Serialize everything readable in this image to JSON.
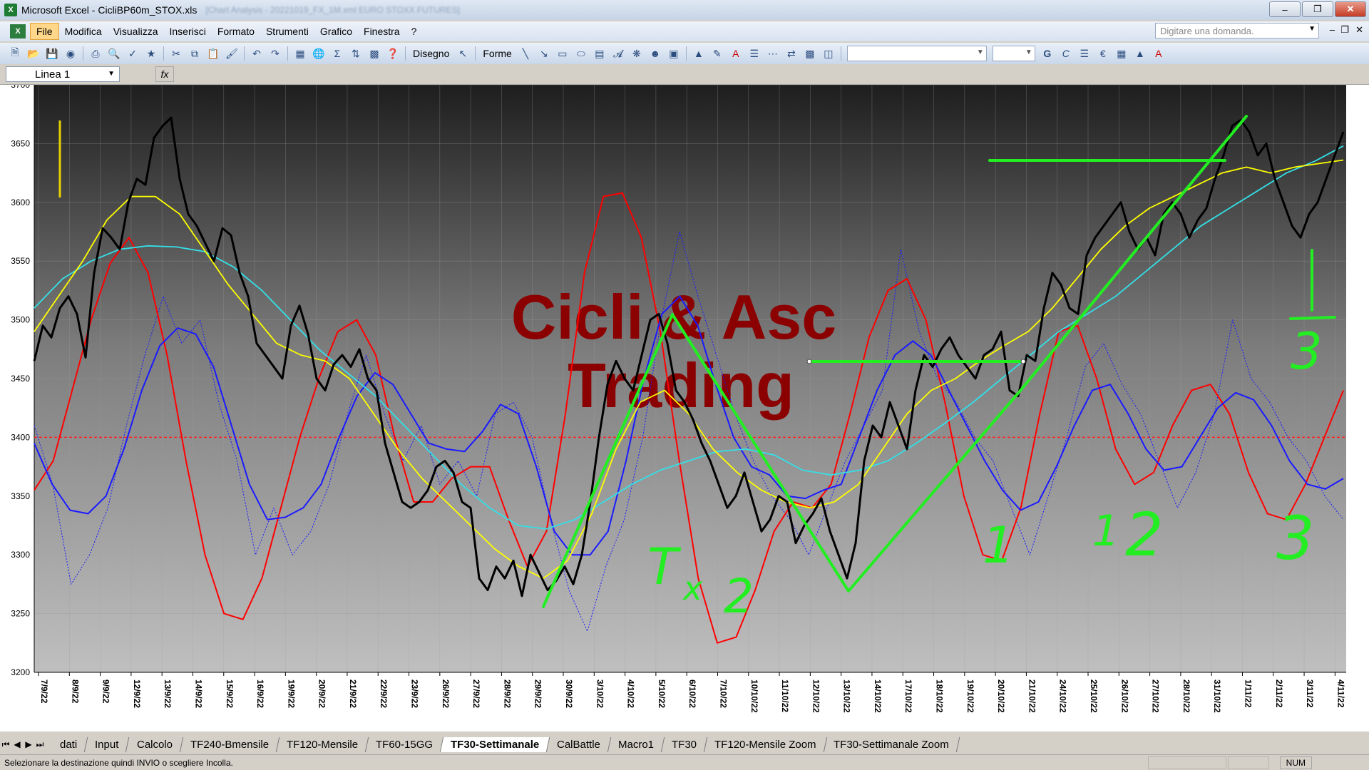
{
  "window": {
    "title": "Microsoft Excel - CicliBP60m_STOX.xls",
    "blurred_tail": "[Chart Analysis - 20221019_FX_1M.xml   EURO STOXX FUTURES]"
  },
  "menu": {
    "items": [
      "File",
      "Modifica",
      "Visualizza",
      "Inserisci",
      "Formato",
      "Strumenti",
      "Grafico",
      "Finestra",
      "?"
    ],
    "ask_placeholder": "Digitare una domanda."
  },
  "toolbar": {
    "draw_label": "Disegno",
    "shapes_label": "Forme",
    "bold": "G",
    "italic": "C",
    "euro": "€"
  },
  "namebox": {
    "value": "Linea 1",
    "fx": "fx"
  },
  "sheets": {
    "tabs": [
      "dati",
      "Input",
      "Calcolo",
      "TF240-Bmensile",
      "TF120-Mensile",
      "TF60-15GG",
      "TF30-Settimanale",
      "CalBattle",
      "Macro1",
      "TF30",
      "TF120-Mensile Zoom",
      "TF30-Settimanale Zoom"
    ],
    "active": "TF30-Settimanale"
  },
  "status": {
    "message": "Selezionare la destinazione quindi INVIO o scegliere Incolla.",
    "num": "NUM"
  },
  "watermark": {
    "line1": "Cicli & Asc",
    "line2": "Trading"
  },
  "colors": {
    "price": "#000000",
    "red_cycle": "#ff0000",
    "blue_cycle": "#1a1aff",
    "yellow_ma": "#ffff00",
    "cyan_ma": "#33e0e8",
    "annotation": "#22ee22",
    "watermark": "#8b0000",
    "dashed_level": "#ff2020"
  },
  "annotations_text": [
    "T",
    "x",
    "2",
    "1",
    "2",
    "3",
    "1",
    "3"
  ],
  "chart_data": {
    "type": "line",
    "title": "",
    "xlabel": "",
    "ylabel": "",
    "ylim": [
      3200,
      3700
    ],
    "yticks": [
      3200,
      3250,
      3300,
      3350,
      3400,
      3450,
      3500,
      3550,
      3600,
      3650,
      3700
    ],
    "xticks": [
      "7/9/22",
      "8/9/22",
      "9/9/22",
      "12/9/22",
      "13/9/22",
      "14/9/22",
      "15/9/22",
      "16/9/22",
      "19/9/22",
      "20/9/22",
      "21/9/22",
      "22/9/22",
      "23/9/22",
      "26/9/22",
      "27/9/22",
      "28/9/22",
      "29/9/22",
      "30/9/22",
      "3/10/22",
      "4/10/22",
      "5/10/22",
      "6/10/22",
      "7/10/22",
      "10/10/22",
      "11/10/22",
      "12/10/22",
      "13/10/22",
      "14/10/22",
      "17/10/22",
      "18/10/22",
      "19/10/22",
      "20/10/22",
      "21/10/22",
      "24/10/22",
      "25/10/22",
      "26/10/22",
      "27/10/22",
      "28/10/22",
      "31/10/22",
      "1/11/22",
      "2/11/22",
      "3/11/22",
      "4/11/22"
    ],
    "reference_line": {
      "y": 3400,
      "style": "dashed"
    },
    "series": [
      {
        "color_key": "price",
        "values": [
          3465,
          3495,
          3485,
          3510,
          3520,
          3505,
          3468,
          3540,
          3578,
          3570,
          3560,
          3600,
          3620,
          3615,
          3655,
          3665,
          3672,
          3620,
          3590,
          3580,
          3565,
          3550,
          3578,
          3572,
          3540,
          3520,
          3480,
          3470,
          3460,
          3450,
          3495,
          3512,
          3488,
          3450,
          3440,
          3462,
          3470,
          3460,
          3475,
          3450,
          3440,
          3395,
          3370,
          3345,
          3340,
          3345,
          3355,
          3375,
          3380,
          3370,
          3345,
          3340,
          3280,
          3270,
          3290,
          3280,
          3295,
          3265,
          3300,
          3285,
          3270,
          3278,
          3290,
          3275,
          3300,
          3345,
          3400,
          3445,
          3465,
          3450,
          3440,
          3470,
          3500,
          3505,
          3480,
          3440,
          3430,
          3415,
          3395,
          3380,
          3360,
          3340,
          3350,
          3370,
          3345,
          3320,
          3330,
          3350,
          3345,
          3310,
          3325,
          3335,
          3348,
          3320,
          3300,
          3280,
          3310,
          3380,
          3410,
          3400,
          3430,
          3410,
          3390,
          3440,
          3470,
          3460,
          3475,
          3485,
          3470,
          3460,
          3450,
          3470,
          3475,
          3490,
          3440,
          3435,
          3470,
          3465,
          3510,
          3540,
          3530,
          3510,
          3505,
          3555,
          3570,
          3580,
          3590,
          3600,
          3575,
          3560,
          3570,
          3555,
          3590,
          3600,
          3590,
          3570,
          3585,
          3595,
          3620,
          3640,
          3665,
          3670,
          3660,
          3640,
          3650,
          3620,
          3600,
          3580,
          3570,
          3590,
          3600,
          3620,
          3640,
          3660
        ]
      },
      {
        "color_key": "yellow_ma",
        "values": [
          3490,
          3520,
          3550,
          3585,
          3605,
          3605,
          3590,
          3560,
          3530,
          3505,
          3480,
          3470,
          3465,
          3450,
          3420,
          3390,
          3365,
          3345,
          3325,
          3305,
          3290,
          3280,
          3295,
          3335,
          3390,
          3430,
          3440,
          3420,
          3390,
          3370,
          3355,
          3345,
          3340,
          3345,
          3360,
          3390,
          3420,
          3440,
          3450,
          3465,
          3478,
          3490,
          3510,
          3535,
          3560,
          3580,
          3595,
          3605,
          3615,
          3625,
          3630,
          3625,
          3630,
          3633,
          3636
        ]
      },
      {
        "color_key": "cyan_ma",
        "values": [
          3510,
          3535,
          3550,
          3560,
          3563,
          3562,
          3558,
          3545,
          3525,
          3500,
          3475,
          3455,
          3435,
          3410,
          3385,
          3360,
          3340,
          3325,
          3322,
          3330,
          3345,
          3360,
          3372,
          3380,
          3388,
          3390,
          3385,
          3372,
          3368,
          3372,
          3380,
          3395,
          3412,
          3430,
          3450,
          3470,
          3490,
          3505,
          3520,
          3540,
          3560,
          3580,
          3595,
          3610,
          3625,
          3635,
          3648
        ]
      },
      {
        "color_key": "red_cycle",
        "values": [
          3355,
          3380,
          3440,
          3500,
          3548,
          3570,
          3540,
          3470,
          3380,
          3300,
          3250,
          3245,
          3280,
          3340,
          3400,
          3450,
          3490,
          3500,
          3470,
          3400,
          3345,
          3345,
          3365,
          3375,
          3375,
          3330,
          3290,
          3320,
          3420,
          3540,
          3605,
          3608,
          3570,
          3490,
          3380,
          3280,
          3225,
          3230,
          3270,
          3320,
          3345,
          3340,
          3360,
          3420,
          3485,
          3525,
          3535,
          3500,
          3430,
          3350,
          3300,
          3295,
          3340,
          3420,
          3490,
          3495,
          3450,
          3390,
          3360,
          3370,
          3410,
          3440,
          3445,
          3420,
          3370,
          3335,
          3330,
          3360,
          3400,
          3440
        ]
      },
      {
        "color_key": "blue_cycle",
        "values": [
          3395,
          3360,
          3338,
          3335,
          3350,
          3390,
          3440,
          3478,
          3493,
          3488,
          3460,
          3410,
          3360,
          3330,
          3332,
          3340,
          3360,
          3400,
          3435,
          3455,
          3445,
          3420,
          3395,
          3390,
          3388,
          3405,
          3428,
          3420,
          3375,
          3320,
          3300,
          3300,
          3320,
          3380,
          3450,
          3505,
          3520,
          3495,
          3445,
          3400,
          3375,
          3368,
          3350,
          3348,
          3355,
          3360,
          3400,
          3440,
          3470,
          3482,
          3470,
          3440,
          3410,
          3380,
          3355,
          3338,
          3345,
          3375,
          3410,
          3440,
          3445,
          3420,
          3390,
          3372,
          3375,
          3400,
          3425,
          3438,
          3432,
          3410,
          3380,
          3360,
          3356,
          3365
        ]
      },
      {
        "color_key": "blue_cycle",
        "style": "dotted",
        "values": [
          3410,
          3360,
          3275,
          3300,
          3340,
          3410,
          3470,
          3520,
          3480,
          3500,
          3430,
          3380,
          3300,
          3340,
          3300,
          3320,
          3360,
          3420,
          3470,
          3420,
          3380,
          3410,
          3360,
          3380,
          3350,
          3420,
          3430,
          3400,
          3330,
          3270,
          3235,
          3290,
          3330,
          3400,
          3500,
          3575,
          3520,
          3470,
          3420,
          3380,
          3350,
          3330,
          3300,
          3340,
          3380,
          3410,
          3440,
          3560,
          3490,
          3450,
          3430,
          3400,
          3380,
          3340,
          3300,
          3350,
          3400,
          3460,
          3480,
          3445,
          3420,
          3380,
          3340,
          3370,
          3420,
          3500,
          3450,
          3430,
          3400,
          3380,
          3350,
          3330
        ]
      }
    ]
  }
}
